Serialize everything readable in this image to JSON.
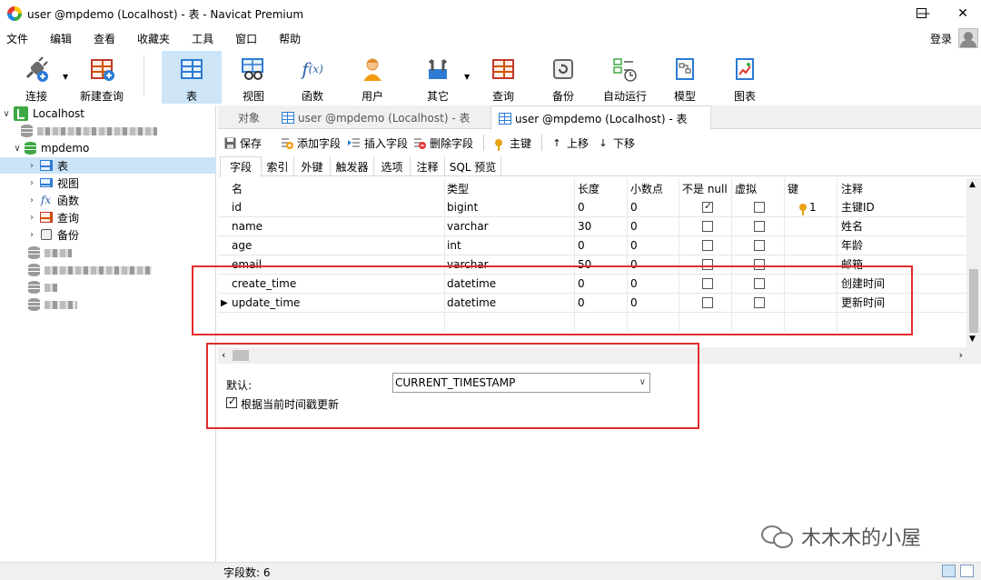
{
  "window": {
    "title": "user @mpdemo (Localhost) - 表 - Navicat Premium",
    "minimize": "—",
    "maximize": "☐",
    "close": "✕"
  },
  "menu": [
    "文件",
    "编辑",
    "查看",
    "收藏夹",
    "工具",
    "窗口",
    "帮助"
  ],
  "login": "登录",
  "toolbar": {
    "connect": "连接",
    "new_query": "新建查询",
    "table": "表",
    "view": "视图",
    "function": "函数",
    "user": "用户",
    "other": "其它",
    "query": "查询",
    "backup": "备份",
    "automation": "自动运行",
    "model": "模型",
    "chart": "图表"
  },
  "tree": {
    "root": "Localhost",
    "db": "mpdemo",
    "items": [
      "表",
      "视图",
      "函数",
      "查询",
      "备份"
    ]
  },
  "tabs": {
    "objects": "对象",
    "tab1": "user @mpdemo (Localhost) - 表",
    "tab2": "user @mpdemo (Localhost) - 表"
  },
  "objtoolbar": {
    "save": "保存",
    "add_field": "添加字段",
    "insert_field": "插入字段",
    "delete_field": "删除字段",
    "primary_key": "主键",
    "move_up": "上移",
    "move_down": "下移"
  },
  "subtabs": [
    "字段",
    "索引",
    "外键",
    "触发器",
    "选项",
    "注释",
    "SQL 预览"
  ],
  "grid": {
    "headers": {
      "name": "名",
      "type": "类型",
      "length": "长度",
      "decimals": "小数点",
      "not_null": "不是 null",
      "virtual": "虚拟",
      "key": "键",
      "comment": "注释"
    },
    "rows": [
      {
        "name": "id",
        "type": "bigint",
        "length": "0",
        "decimals": "0",
        "not_null": true,
        "virtual": false,
        "key": "1",
        "comment": "主键ID"
      },
      {
        "name": "name",
        "type": "varchar",
        "length": "30",
        "decimals": "0",
        "not_null": false,
        "virtual": false,
        "key": "",
        "comment": "姓名"
      },
      {
        "name": "age",
        "type": "int",
        "length": "0",
        "decimals": "0",
        "not_null": false,
        "virtual": false,
        "key": "",
        "comment": "年龄"
      },
      {
        "name": "email",
        "type": "varchar",
        "length": "50",
        "decimals": "0",
        "not_null": false,
        "virtual": false,
        "key": "",
        "comment": "邮箱"
      },
      {
        "name": "create_time",
        "type": "datetime",
        "length": "0",
        "decimals": "0",
        "not_null": false,
        "virtual": false,
        "key": "",
        "comment": "创建时间"
      },
      {
        "name": "update_time",
        "type": "datetime",
        "length": "0",
        "decimals": "0",
        "not_null": false,
        "virtual": false,
        "key": "",
        "comment": "更新时间"
      }
    ]
  },
  "props": {
    "default_label": "默认:",
    "default_value": "CURRENT_TIMESTAMP",
    "on_update_label": "根据当前时间戳更新"
  },
  "status": {
    "field_count": "字段数: 6"
  },
  "watermark": "木木木的小屋"
}
